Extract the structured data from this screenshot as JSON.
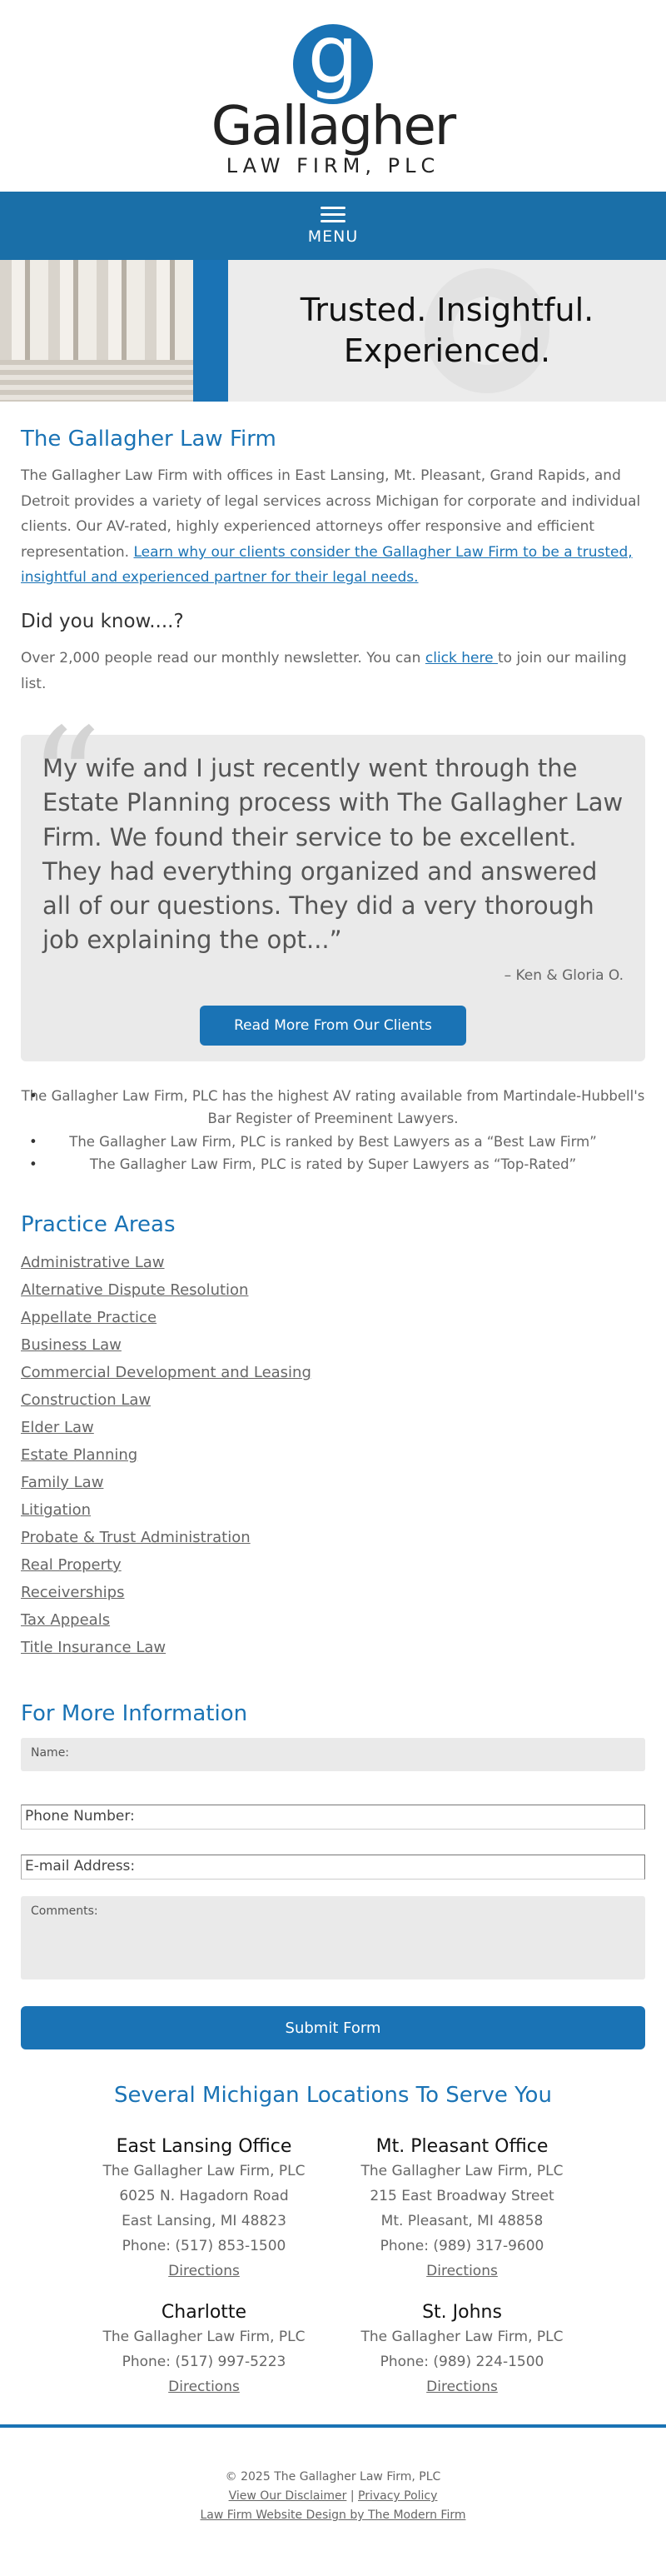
{
  "header": {
    "logo_letter": "g",
    "logo_name": "Gallagher",
    "logo_sub": "LAW FIRM, PLC"
  },
  "nav": {
    "menu_label": "MENU"
  },
  "hero": {
    "line1": "Trusted. Insightful.",
    "line2": "Experienced."
  },
  "intro": {
    "title": "The Gallagher Law Firm",
    "body": "The Gallagher Law Firm with offices in East Lansing, Mt. Pleasant, Grand Rapids, and Detroit provides a variety of legal services across Michigan for corporate and individual clients. Our AV-rated, highly experienced attorneys offer responsive and efficient representation. ",
    "link": "Learn why our clients consider the Gallagher Law Firm to be a trusted, insightful and experienced partner for their legal needs.",
    "didyouknow_title": "Did you know....?",
    "newsletter_pre": "Over 2,000 people read our monthly newsletter. You can ",
    "newsletter_link": "click here ",
    "newsletter_post": "to join our mailing list."
  },
  "testimonial": {
    "quote": "My wife and I just recently went through the Estate Planning process with The Gallagher Law Firm. We found their service to be excellent. They had everything organized and answered all of our questions. They did a very thorough job explaining the opt...”",
    "author": "– Ken & Gloria O.",
    "button": "Read More From Our Clients"
  },
  "ratings": [
    "The Gallagher Law Firm, PLC has the highest AV rating available from Martindale-Hubbell's Bar Register of Preeminent Lawyers.",
    "The Gallagher Law Firm, PLC is ranked by Best Lawyers as a “Best Law Firm”",
    "The Gallagher Law Firm, PLC is rated by Super Lawyers as “Top-Rated”"
  ],
  "practice": {
    "title": "Practice Areas",
    "items": [
      "Administrative Law",
      "Alternative Dispute Resolution",
      "Appellate Practice",
      "Business Law",
      "Commercial Development and Leasing",
      "Construction Law",
      "Elder Law",
      "Estate Planning",
      "Family Law",
      "Litigation",
      "Probate & Trust Administration",
      "Real Property",
      "Receiverships",
      "Tax Appeals",
      "Title Insurance Law"
    ]
  },
  "form": {
    "title": "For More Information",
    "name_label": "Name:",
    "phone_label": "Phone Number:",
    "email_label": "E-mail Address:",
    "comments_label": "Comments:",
    "submit": "Submit Form"
  },
  "locations": {
    "title": "Several Michigan Locations To Serve You",
    "offices": [
      {
        "name": "East Lansing Office",
        "firm": "The Gallagher Law Firm, PLC",
        "address1": "6025 N. Hagadorn Road",
        "address2": "East Lansing, MI 48823",
        "phone": "Phone: (517) 853-1500",
        "directions": "Directions"
      },
      {
        "name": "Mt. Pleasant Office",
        "firm": "The Gallagher Law Firm, PLC",
        "address1": "215 East Broadway Street",
        "address2": "Mt. Pleasant, MI 48858",
        "phone": "Phone: (989) 317-9600",
        "directions": "Directions"
      },
      {
        "name": "Charlotte",
        "firm": "The Gallagher Law Firm, PLC",
        "phone": "Phone: (517) 997-5223",
        "directions": "Directions"
      },
      {
        "name": "St. Johns",
        "firm": "The Gallagher Law Firm, PLC",
        "phone": "Phone: (989) 224-1500",
        "directions": "Directions"
      }
    ]
  },
  "footer": {
    "copyright": "© 2025 The Gallagher Law Firm, PLC",
    "disclaimer": "View Our Disclaimer",
    "separator": " | ",
    "privacy": "Privacy Policy",
    "design": "Law Firm Website Design by The Modern Firm"
  },
  "colors": {
    "accent": "#1a73b5",
    "nav": "#1a6fa8",
    "panel": "#eaeaea"
  }
}
